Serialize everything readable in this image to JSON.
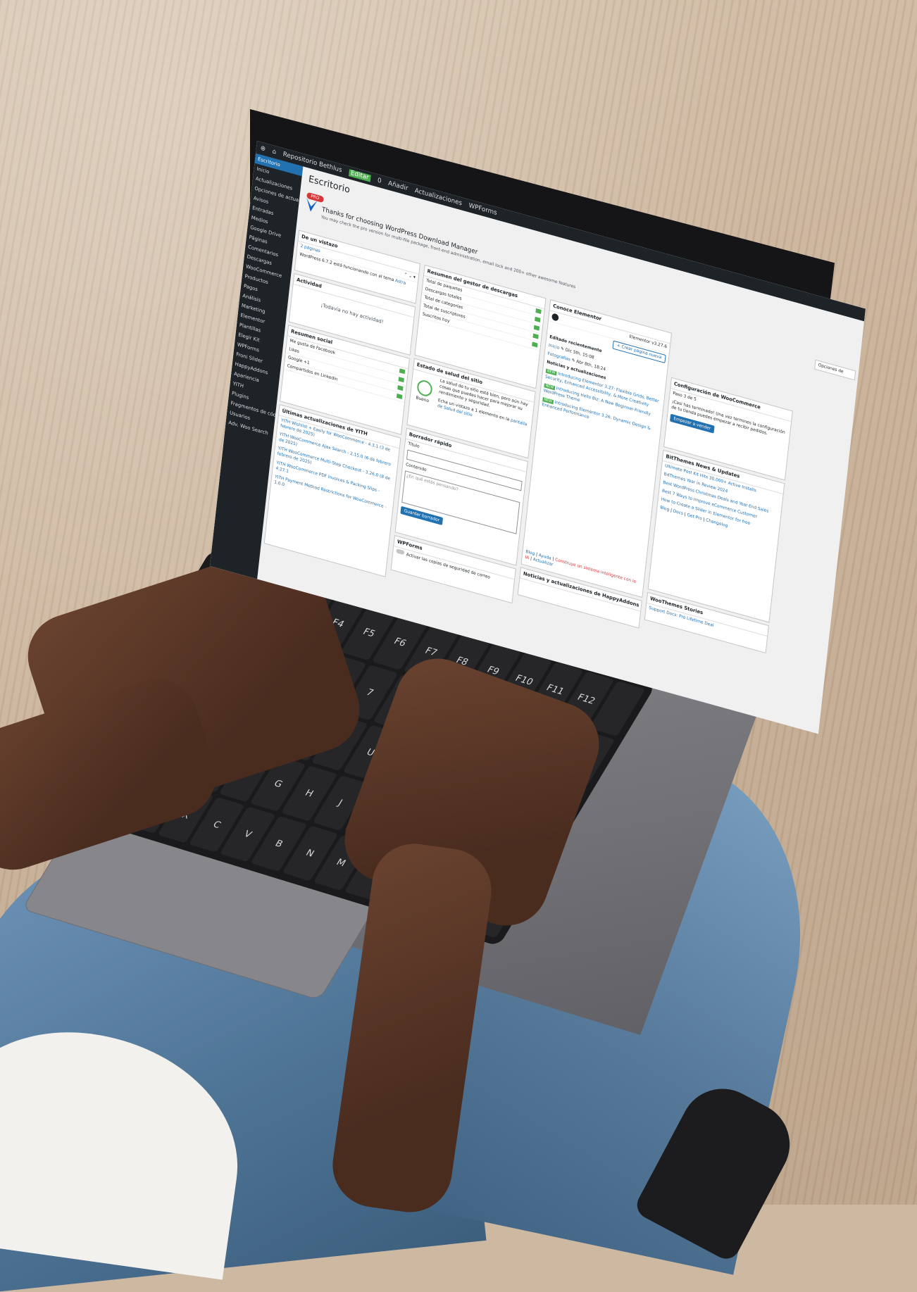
{
  "wp": {
    "topbar": {
      "site": "Repositorio Bethlus",
      "mode": "Editar",
      "counter": "0",
      "new_label": "Añadir",
      "updates": "Actualizaciones",
      "wpforms": "WPForms"
    },
    "sidebar": {
      "items": [
        {
          "label": "Escritorio"
        },
        {
          "label": "Inicio"
        },
        {
          "label": "Actualizaciones"
        },
        {
          "label": "Opciones de actualizaciones"
        },
        {
          "label": "Avisos"
        },
        {
          "label": "Entradas"
        },
        {
          "label": "Medios"
        },
        {
          "label": "Google Drive"
        },
        {
          "label": "Páginas"
        },
        {
          "label": "Comentarios"
        },
        {
          "label": "Descargas"
        },
        {
          "label": "WooCommerce"
        },
        {
          "label": "Productos"
        },
        {
          "label": "Pagos"
        },
        {
          "label": "Análisis"
        },
        {
          "label": "Marketing"
        },
        {
          "label": "Elementor"
        },
        {
          "label": "Plantillas"
        },
        {
          "label": "Elegir Kit"
        },
        {
          "label": "WPForms"
        },
        {
          "label": "Froni Slider"
        },
        {
          "label": "HappyAddons"
        },
        {
          "label": "Apariencia"
        },
        {
          "label": "YITH"
        },
        {
          "label": "Plugins"
        },
        {
          "label": "Fragmentos de código"
        },
        {
          "label": "Usuarios"
        },
        {
          "label": "Adv. Woo Search"
        }
      ]
    },
    "main": {
      "title": "Escritorio",
      "badge": "PRO",
      "notice_title": "Thanks for choosing WordPress Download Manager",
      "notice_sub": "You may check the pro version for multi-file package, front-end administration, email lock and 200+ other awesome features",
      "options_btn": "Opciones de",
      "glance": {
        "title": "De un vistazo",
        "row1": "2 páginas",
        "footer": "WordPress 6.7.2 está funcionando con el tema",
        "footer_link": "Astra"
      },
      "activity": {
        "title": "Actividad",
        "empty": "¡Todavía no hay actividad!"
      },
      "social": {
        "title": "Resumen social",
        "rows": [
          "Me gusta de Facebook",
          "Likes",
          "Google +1",
          "Compartidos en Linkedin"
        ]
      },
      "yith": {
        "title": "Últimas actualizaciones de YITH",
        "items": [
          "YITH Wishlist + Easily for WooCommerce - 4.3.1 (3 de febrero de 2025)",
          "YITH WooCommerce Ajax Search - 2.15.0 (6 de febrero de 2025)",
          "YITH WooCommerce Multi-Step Checkout - 3.26.0 (8 de febrero de 2025)",
          "YITH WooCommerce PDF Invoices & Packing Slips - 4.27.1",
          "YITH Payment Method Restrictions for WooCommerce - 1.0.0"
        ]
      },
      "downloads": {
        "title": "Resumen del gestor de descargas",
        "rows": [
          "Total de paquetes",
          "Descargas totales",
          "Total de categorías",
          "Total de suscriptores",
          "Suscritos hoy"
        ]
      },
      "health": {
        "title": "Estado de salud del sitio",
        "status": "Bueno",
        "text": "La salud de tu sitio está bien, pero aún hay cosas que puedes hacer para mejorar su rendimiento y seguridad.",
        "text2": "Echa un vistazo a 1 elemento en la",
        "link": "pantalla de Salud del sitio"
      },
      "draft": {
        "title": "Borrador rápido",
        "title_label": "Título",
        "content_label": "Contenido",
        "content_placeholder": "¿En qué estás pensando?",
        "save": "Guardar borrador"
      },
      "wpforms_box": {
        "title": "WPForms",
        "text": "Activar las copias de seguridad de correo"
      },
      "elementor": {
        "title": "Conoce Elementor",
        "version": "Elementor v3.27.6",
        "create_btn": "+ Crear página nueva",
        "recent_title": "Editado recientemente",
        "recent": [
          "Inicio",
          "Fotografías"
        ],
        "recent_dates": [
          "Dic 5th, 15:08",
          "Abr 8th, 18:24"
        ],
        "news_title": "Noticias y actualizaciones",
        "news": [
          {
            "badge": "NEW",
            "title": "Introducing Elementor 3.27: Flexible Grids, Better Security, Enhanced Accessibility, & More Creativity"
          },
          {
            "badge": "NEW",
            "title": "Introducing Hello Biz: A New Beginner-Friendly WordPress Theme"
          },
          {
            "badge": "NEW",
            "title": "Introducing Elementor 3.26: Dynamic Design & Enhanced Performance"
          }
        ],
        "footer": [
          "Blog",
          "Ayuda",
          "Construye un sistema inteligente con la IA",
          "Actualizar"
        ]
      },
      "happy": {
        "title": "Noticias y actualizaciones de HappyAddons"
      },
      "woo": {
        "title": "Configuración de WooCommerce",
        "steps": "Paso 3 de 5",
        "text": "¡Casi has terminado! Una vez termines la configuración de tu tienda puedes empezar a recibir pedidos.",
        "btn": "Empezar a vender"
      },
      "bitthemes": {
        "title": "BitThemes News & Updates",
        "items": [
          "Ultimate Post Kit Hits 30,000+ Active Installs",
          "BdThemes Year in Review 2024",
          "Best WordPress Christmas Deals and Year-End Sales",
          "Best 7 Ways to Improve eCommerce Customer",
          "How to Create a Slider in Elementor for free"
        ],
        "footer": [
          "Blog",
          "Docs",
          "Get Pro",
          "Changelog"
        ]
      },
      "storefront": {
        "title": "WooThemes Stories",
        "item": "Support Docs: Pro Lifetime Deal"
      }
    }
  }
}
